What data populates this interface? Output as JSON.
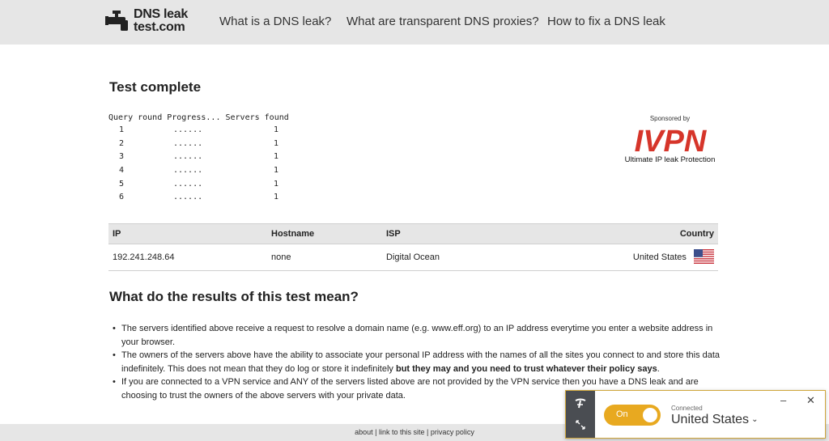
{
  "header": {
    "logo_line1": "DNS leak",
    "logo_line2": "test.com",
    "nav": [
      "What is a DNS leak?",
      "What are transparent DNS proxies?",
      "How to fix a DNS leak"
    ]
  },
  "main": {
    "title": "Test complete",
    "progress": {
      "header": "Query round Progress... Servers found",
      "rows": [
        {
          "round": "1",
          "progress": "......",
          "servers": "1"
        },
        {
          "round": "2",
          "progress": "......",
          "servers": "1"
        },
        {
          "round": "3",
          "progress": "......",
          "servers": "1"
        },
        {
          "round": "4",
          "progress": "......",
          "servers": "1"
        },
        {
          "round": "5",
          "progress": "......",
          "servers": "1"
        },
        {
          "round": "6",
          "progress": "......",
          "servers": "1"
        }
      ]
    },
    "sponsor": {
      "sponsored_by": "Sponsored by",
      "brand": "IVPN",
      "tagline": "Ultimate IP leak Protection",
      "brand_color": "#d6352a"
    },
    "results": {
      "columns": [
        "IP",
        "Hostname",
        "ISP",
        "Country"
      ],
      "rows": [
        {
          "ip": "192.241.248.64",
          "hostname": "none",
          "isp": "Digital Ocean",
          "country": "United States",
          "flag_icon": "us-flag-icon"
        }
      ]
    },
    "explanation": {
      "title": "What do the results of this test mean?",
      "bullets": [
        {
          "text": "The servers identified above receive a request to resolve a domain name (e.g. www.eff.org) to an IP address everytime you enter a website address in your browser."
        },
        {
          "text": "The owners of the servers above have the ability to associate your personal IP address with the names of all the sites you connect to and store this data indefinitely. This does not mean that they do log or store it indefinitely ",
          "bold": "but they may and you need to trust whatever their policy says",
          "tail": "."
        },
        {
          "text": "If you are connected to a VPN service and ANY of the servers listed above are not provided by the VPN service then you have a DNS leak and are choosing to trust the owners of the above servers with your private data."
        }
      ]
    }
  },
  "footer": {
    "about": "about",
    "link": "link to this site",
    "privacy": "privacy policy",
    "sep": " | "
  },
  "vpn_widget": {
    "toggle_label": "On",
    "status": "Connected",
    "location": "United States",
    "minimize_symbol": "–",
    "close_symbol": "✕",
    "chevron_symbol": "⌄",
    "accent_color": "#e8a920"
  }
}
